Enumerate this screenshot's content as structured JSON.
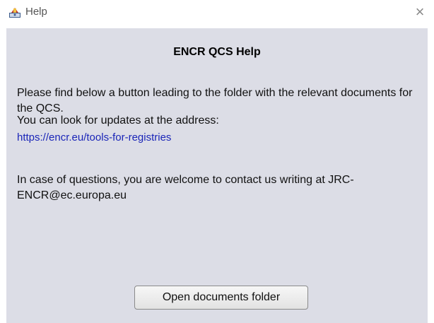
{
  "window": {
    "title": "Help",
    "icon": "java-app-icon",
    "close_glyph": "×"
  },
  "dialog": {
    "heading": "ENCR QCS Help",
    "paragraph1": "Please find below a button leading to the folder with the relevant documents for the QCS.",
    "paragraph2": "You can look for updates at the address:",
    "link_text": "https://encr.eu/tools-for-registries",
    "paragraph3": "In case of questions, you are welcome to contact us writing at JRC-ENCR@ec.europa.eu",
    "button_label": "Open documents folder"
  },
  "colors": {
    "panel_background": "#dcdde6",
    "link": "#1a25b8"
  }
}
